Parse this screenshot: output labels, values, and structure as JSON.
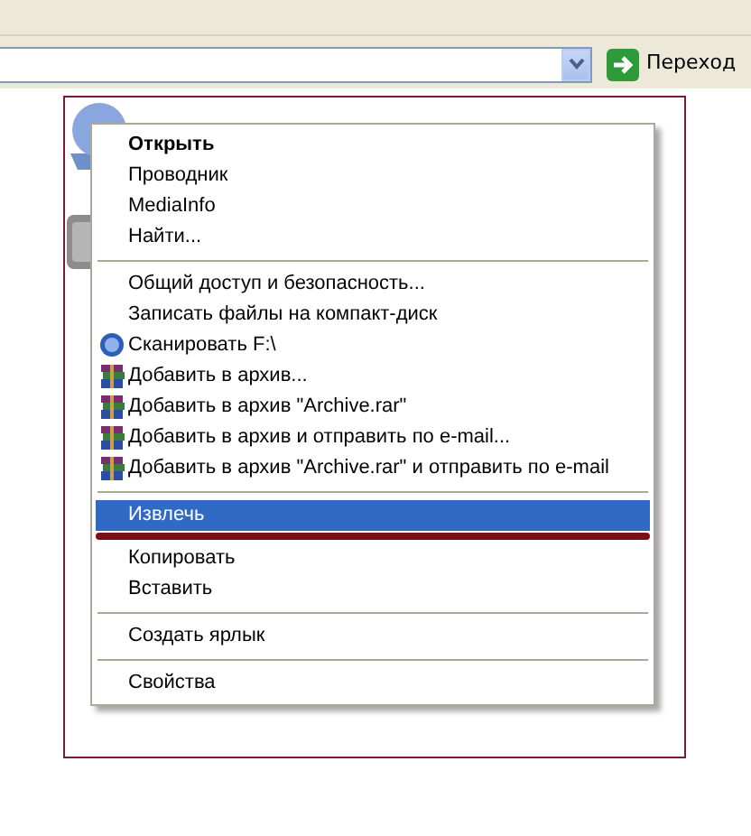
{
  "address_bar": {
    "go_label": "Переход"
  },
  "context_menu": {
    "items": [
      {
        "kind": "item",
        "label": "Открыть",
        "default": true,
        "selected": false
      },
      {
        "kind": "item",
        "label": "Проводник",
        "default": false,
        "selected": false
      },
      {
        "kind": "item",
        "label": "MediaInfo",
        "default": false,
        "selected": false
      },
      {
        "kind": "item",
        "label": "Найти...",
        "default": false,
        "selected": false
      },
      {
        "kind": "separator"
      },
      {
        "kind": "item",
        "label": "Общий доступ и безопасность...",
        "default": false,
        "selected": false
      },
      {
        "kind": "item",
        "label": "Записать файлы на компакт-диск",
        "default": false,
        "selected": false
      },
      {
        "kind": "scan",
        "label": "Сканировать F:\\",
        "default": false,
        "selected": false
      },
      {
        "kind": "archive",
        "label": "Добавить в архив...",
        "default": false,
        "selected": false
      },
      {
        "kind": "archive",
        "label": "Добавить в архив \"Archive.rar\"",
        "default": false,
        "selected": false
      },
      {
        "kind": "archive",
        "label": "Добавить в архив и отправить по e-mail...",
        "default": false,
        "selected": false
      },
      {
        "kind": "archive",
        "label": "Добавить в архив \"Archive.rar\" и отправить по e-mail",
        "default": false,
        "selected": false
      },
      {
        "kind": "separator"
      },
      {
        "kind": "item",
        "label": "Извлечь",
        "default": false,
        "selected": true,
        "underlined": true
      },
      {
        "kind": "item",
        "label": "Копировать",
        "default": false,
        "selected": false
      },
      {
        "kind": "item",
        "label": "Вставить",
        "default": false,
        "selected": false
      },
      {
        "kind": "separator"
      },
      {
        "kind": "item",
        "label": "Создать ярлык",
        "default": false,
        "selected": false
      },
      {
        "kind": "separator"
      },
      {
        "kind": "item",
        "label": "Свойства",
        "default": false,
        "selected": false
      }
    ]
  }
}
